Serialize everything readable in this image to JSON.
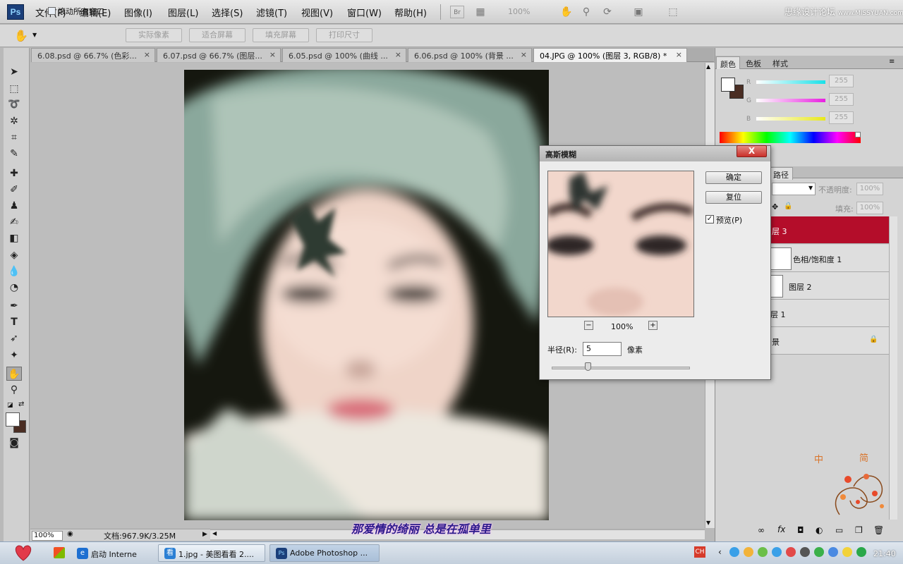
{
  "app": {
    "logo": "Ps",
    "watermark": "思缘设计论坛",
    "watermark_site": "www.MISSYUAN.com"
  },
  "menu": [
    "文件(F)",
    "编辑(E)",
    "图像(I)",
    "图层(L)",
    "选择(S)",
    "滤镜(T)",
    "视图(V)",
    "窗口(W)",
    "帮助(H)"
  ],
  "menubar_zoom": "100%",
  "options": {
    "scroll_all_label": "滚动所有窗口",
    "buttons": [
      "实际像素",
      "适合屏幕",
      "填充屏幕",
      "打印尺寸"
    ]
  },
  "tabs": [
    {
      "label": "6.08.psd @ 66.7% (色彩..."
    },
    {
      "label": "6.07.psd @ 66.7% (图层..."
    },
    {
      "label": "6.05.psd @ 100% (曲线 ..."
    },
    {
      "label": "6.06.psd @ 100% (背景 ..."
    },
    {
      "label": "04.JPG @ 100% (图层 3, RGB/8) *"
    }
  ],
  "tab_close": "×",
  "status": {
    "zoom": "100%",
    "doc": "文档:967.9K/3.25M"
  },
  "color_panel": {
    "tabs": [
      "颜色",
      "色板",
      "样式"
    ],
    "channels": [
      {
        "label": "R",
        "value": "255",
        "color": "#19e0e8"
      },
      {
        "label": "G",
        "value": "255",
        "color": "#e81fe0"
      },
      {
        "label": "B",
        "value": "255",
        "color": "#e8e81a"
      }
    ],
    "foreground": "#ffffff",
    "background": "#4a2d23"
  },
  "layers_panel": {
    "tab": "路径",
    "opacity_label": "不透明度:",
    "opacity_value": "100%",
    "fill_label": "填充:",
    "fill_value": "100%",
    "layers": [
      {
        "name": "层 3",
        "selected": true
      },
      {
        "name": "色相/饱和度 1",
        "selected": false
      },
      {
        "name": "图层 2",
        "selected": false
      },
      {
        "name": "层 1",
        "selected": false
      },
      {
        "name": "景",
        "selected": false
      }
    ]
  },
  "dialog": {
    "title": "高斯模糊",
    "close": "X",
    "ok": "确定",
    "reset": "复位",
    "preview_label": "预览(P)",
    "preview_check": "✓",
    "zoom_minus": "−",
    "zoom_plus": "+",
    "zoom": "100%",
    "radius_label": "半径(R):",
    "radius_value": "5",
    "radius_unit": "像素"
  },
  "caption": "那爱情的绮丽 总是在孤单里",
  "deco_text": [
    "中",
    "简"
  ],
  "taskbar": {
    "items": [
      {
        "label": "启动 Interne",
        "icon": "e"
      },
      {
        "label": "1.jpg - 美图看看 2....",
        "icon": "看"
      },
      {
        "label": "Adobe Photoshop ...",
        "icon": "Ps"
      }
    ],
    "ime": "CH",
    "clock": "21:40"
  }
}
